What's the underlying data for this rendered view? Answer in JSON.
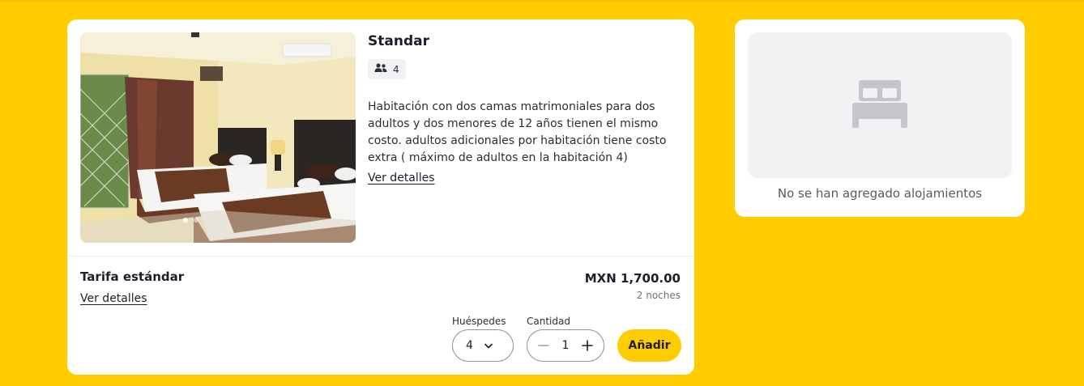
{
  "room": {
    "title": "Standar",
    "guests_capacity": "4",
    "description": "Habitación con dos camas matrimoniales para dos adultos y dos menores de 12 años tienen el mismo costo. adultos adicionales por habitación tiene costo extra ( máximo de adultos en la habitación 4)",
    "details_link": "Ver detalles",
    "photo_icon": "hotel-room-photo"
  },
  "rate": {
    "name": "Tarifa estándar",
    "details_link": "Ver detalles",
    "price": "MXN 1,700.00",
    "nights": "2 noches"
  },
  "booking": {
    "guests_label": "Huéspedes",
    "guests_value": "4",
    "quantity_label": "Cantidad",
    "quantity_value": "1",
    "add_button": "Añadir"
  },
  "cart": {
    "empty_message": "No se han agregado alojamientos",
    "empty_icon": "bed-icon"
  },
  "colors": {
    "background": "#FFCC00",
    "accent": "#FFCC00",
    "card": "#FFFFFF",
    "placeholder": "#F1F2F4"
  }
}
